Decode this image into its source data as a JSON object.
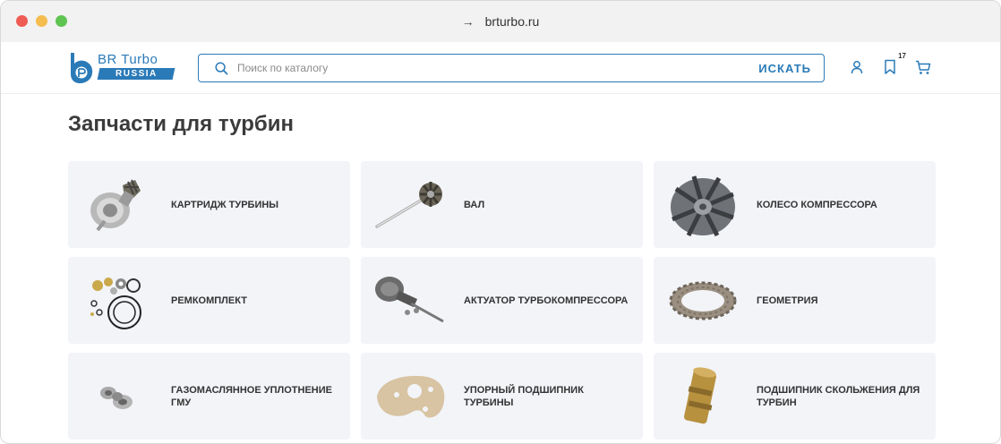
{
  "browser": {
    "url": "brturbo.ru"
  },
  "header": {
    "logo": {
      "top": "BR Turbo",
      "bottom": "RUSSIA"
    },
    "search": {
      "placeholder": "Поиск по каталогу",
      "value": "",
      "button": "ИСКАТЬ"
    },
    "icons": [
      "user-icon",
      "bookmark-icon",
      "cart-icon"
    ],
    "bookmark_count": "17"
  },
  "page": {
    "title": "Запчасти для турбин"
  },
  "categories": [
    {
      "label": "КАРТРИДЖ ТУРБИНЫ",
      "icon": "turbo-cartridge-image"
    },
    {
      "label": "ВАЛ",
      "icon": "shaft-image"
    },
    {
      "label": "КОЛЕСО КОМПРЕССОРА",
      "icon": "compressor-wheel-image"
    },
    {
      "label": "РЕМКОМПЛЕКТ",
      "icon": "repair-kit-image"
    },
    {
      "label": "АКТУАТОР ТУРБОКОМПРЕССОРА",
      "icon": "actuator-image"
    },
    {
      "label": "ГЕОМЕТРИЯ",
      "icon": "geometry-ring-image"
    },
    {
      "label": "ГАЗОМАСЛЯННОЕ УПЛОТНЕНИЕ ГМУ",
      "icon": "oil-seal-image"
    },
    {
      "label": "УПОРНЫЙ ПОДШИПНИК ТУРБИНЫ",
      "icon": "thrust-bearing-image"
    },
    {
      "label": "ПОДШИПНИК СКОЛЬЖЕНИЯ ДЛЯ ТУРБИН",
      "icon": "journal-bearing-image"
    }
  ],
  "colors": {
    "brand": "#2a7ab8",
    "card_bg": "#f2f4f8",
    "text": "#333333"
  }
}
